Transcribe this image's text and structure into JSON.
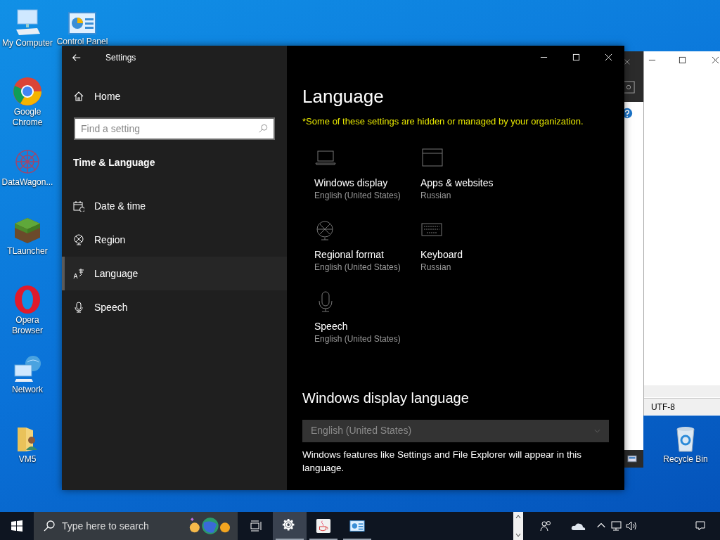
{
  "desktop_icons": [
    {
      "label": "My Computer",
      "kind": "computer"
    },
    {
      "label": "Control Panel",
      "kind": "panel"
    },
    {
      "label": "Google Chrome",
      "kind": "browser"
    },
    {
      "label": "DataWagon...",
      "kind": "pattern"
    },
    {
      "label": "TLauncher",
      "kind": "block"
    },
    {
      "label": "Opera Browser",
      "kind": "ring"
    },
    {
      "label": "Network",
      "kind": "network"
    },
    {
      "label": "VM5",
      "kind": "folder"
    },
    {
      "label": "Recycle Bin",
      "kind": "bin"
    }
  ],
  "background_window": {
    "status": "UTF-8"
  },
  "settings": {
    "title": "Settings",
    "home": "Home",
    "search": {
      "placeholder": "Find a setting"
    },
    "section": "Time & Language",
    "nav": [
      {
        "label": "Date & time",
        "kind": "calendar",
        "selected": false
      },
      {
        "label": "Region",
        "kind": "globe",
        "selected": false
      },
      {
        "label": "Language",
        "kind": "language",
        "selected": true
      },
      {
        "label": "Speech",
        "kind": "mic",
        "selected": false
      }
    ],
    "page_title": "Language",
    "notice": "*Some of these settings are hidden or managed by your organization.",
    "tiles": [
      {
        "title": "Windows display",
        "subtitle": "English (United States)",
        "kind": "laptop"
      },
      {
        "title": "Apps & websites",
        "subtitle": "Russian",
        "kind": "window"
      },
      {
        "title": "Regional format",
        "subtitle": "English (United States)",
        "kind": "globe"
      },
      {
        "title": "Keyboard",
        "subtitle": "Russian",
        "kind": "keyboard"
      },
      {
        "title": "Speech",
        "subtitle": "English (United States)",
        "kind": "mic"
      }
    ],
    "display_language": {
      "heading": "Windows display language",
      "value": "English (United States)",
      "disabled": true,
      "description": "Windows features like Settings and File Explorer will appear in this language."
    }
  },
  "taskbar": {
    "search": {
      "placeholder": "Type here to search"
    },
    "apps": [
      {
        "kind": "gear",
        "selected": true
      },
      {
        "kind": "cup",
        "selected": false
      },
      {
        "kind": "panel",
        "selected": false
      }
    ]
  }
}
